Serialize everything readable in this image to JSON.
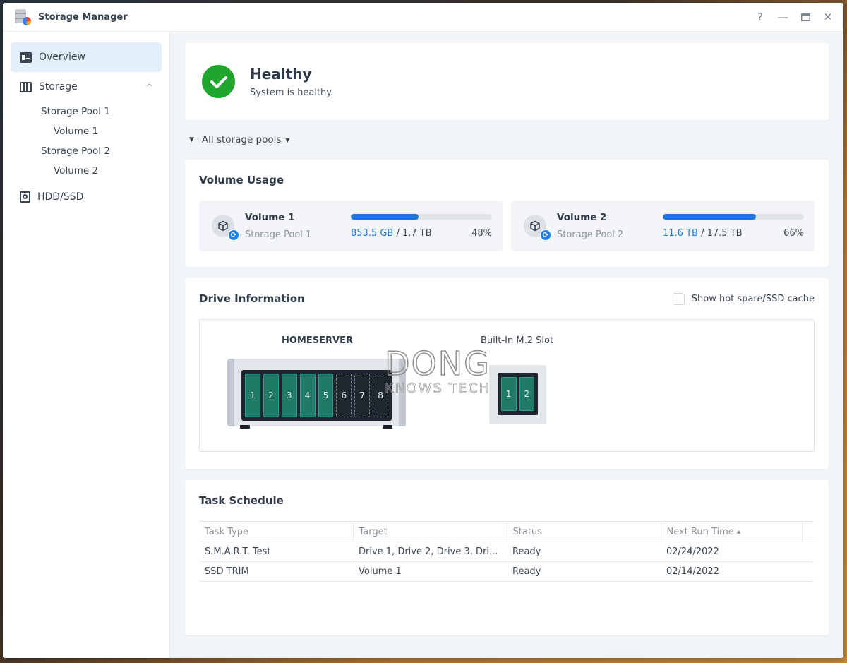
{
  "window": {
    "title": "Storage Manager",
    "controls": {
      "help": "?",
      "minimize": "—",
      "maximize": "▭",
      "close": "✕"
    }
  },
  "sidebar": {
    "items": [
      {
        "label": "Overview",
        "icon": "overview-icon",
        "active": true
      },
      {
        "label": "Storage",
        "icon": "storage-icon",
        "expanded": true,
        "children": [
          {
            "label": "Storage Pool 1",
            "children": [
              {
                "label": "Volume 1"
              }
            ]
          },
          {
            "label": "Storage Pool 2",
            "children": [
              {
                "label": "Volume 2"
              }
            ]
          }
        ]
      },
      {
        "label": "HDD/SSD",
        "icon": "hdd-icon"
      }
    ]
  },
  "health": {
    "status": "Healthy",
    "message": "System is healthy.",
    "color": "#1fa72d"
  },
  "filter": {
    "label": "All storage pools"
  },
  "volume_usage": {
    "title": "Volume Usage",
    "volumes": [
      {
        "name": "Volume 1",
        "pool": "Storage Pool 1",
        "used": "853.5 GB",
        "total": "1.7 TB",
        "percent_label": "48%",
        "percent": 48
      },
      {
        "name": "Volume 2",
        "pool": "Storage Pool 2",
        "used": "11.6 TB",
        "total": "17.5 TB",
        "percent_label": "66%",
        "percent": 66
      }
    ]
  },
  "drive_info": {
    "title": "Drive Information",
    "hot_spare_label": "Show hot spare/SSD cache",
    "hot_spare_checked": false,
    "nas_name": "HOMESERVER",
    "m2_label": "Built-In M.2 Slot",
    "bays": [
      {
        "number": "1",
        "installed": true
      },
      {
        "number": "2",
        "installed": true
      },
      {
        "number": "3",
        "installed": true
      },
      {
        "number": "4",
        "installed": true
      },
      {
        "number": "5",
        "installed": true
      },
      {
        "number": "6",
        "installed": false
      },
      {
        "number": "7",
        "installed": false
      },
      {
        "number": "8",
        "installed": false
      }
    ],
    "m2_slots": [
      {
        "number": "1"
      },
      {
        "number": "2"
      }
    ],
    "watermark": {
      "line1": "DONG",
      "line2": "KNOWS TECH"
    }
  },
  "task_schedule": {
    "title": "Task Schedule",
    "columns": [
      "Task Type",
      "Target",
      "Status",
      "Next Run Time"
    ],
    "sort_indicator": "▲",
    "rows": [
      [
        "S.M.A.R.T. Test",
        "Drive 1, Drive 2, Drive 3, Dri...",
        "Ready",
        "02/24/2022"
      ],
      [
        "SSD TRIM",
        "Volume 1",
        "Ready",
        "02/14/2022"
      ]
    ]
  },
  "colors": {
    "accent": "#1677d9",
    "drive": "#1f7a68",
    "healthy": "#1fa72d"
  }
}
